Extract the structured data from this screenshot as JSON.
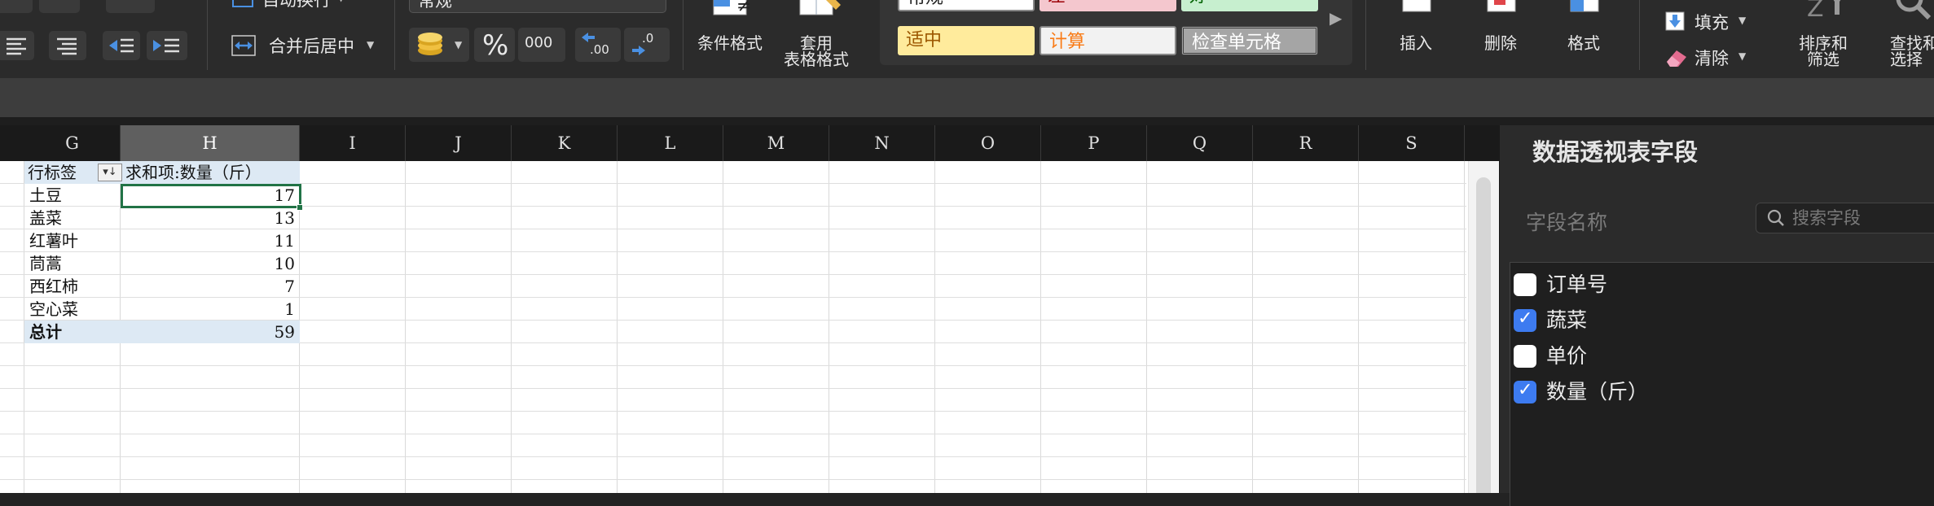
{
  "ribbon": {
    "wrap_text": "自动换行",
    "merge_center": "合并后居中",
    "number_format": "常规",
    "percent": "%",
    "thousands": "000",
    "inc_decimal": ".00",
    "dec_decimal": ".0",
    "conditional_format": "条件格式",
    "table_format_line1": "套用",
    "table_format_line2": "表格格式",
    "style_normal": "常规",
    "style_bad": "差",
    "style_good": "好",
    "style_neutral": "适中",
    "style_calc": "计算",
    "style_check": "检查单元格",
    "insert": "插入",
    "delete": "删除",
    "format": "格式",
    "fill": "填充",
    "clear": "清除",
    "sort_filter_line1": "排序和",
    "sort_filter_line2": "筛选",
    "find_select_line1": "查找和",
    "find_select_line2": "选择"
  },
  "sheet": {
    "columns": [
      "G",
      "H",
      "I",
      "J",
      "K",
      "L",
      "M",
      "N",
      "O",
      "P",
      "Q",
      "R",
      "S"
    ],
    "selected_column": "H",
    "pivot_header": {
      "row_label": "行标签",
      "value_label": "求和项:数量（斤）"
    },
    "rows": [
      {
        "label": "土豆",
        "value": "17"
      },
      {
        "label": "盖菜",
        "value": "13"
      },
      {
        "label": "红薯叶",
        "value": "11"
      },
      {
        "label": "茼蒿",
        "value": "10"
      },
      {
        "label": "西红柿",
        "value": "7"
      },
      {
        "label": "空心菜",
        "value": "1"
      }
    ],
    "total": {
      "label": "总计",
      "value": "59"
    }
  },
  "pivot_panel": {
    "title": "数据透视表字段",
    "field_name_label": "字段名称",
    "search_placeholder": "搜索字段",
    "fields": [
      {
        "name": "订单号",
        "checked": false
      },
      {
        "name": "蔬菜",
        "checked": true
      },
      {
        "name": "单价",
        "checked": false
      },
      {
        "name": "数量（斤）",
        "checked": true
      }
    ]
  },
  "colors": {
    "accent_green": "#217346",
    "checkbox_blue": "#3d7bf0",
    "pivot_band": "#dde9f4",
    "style_bad_bg": "#f4c7ce",
    "style_good_bg": "#c7efcf",
    "style_neutral_bg": "#ffeb9c",
    "style_calc_fg": "#f97b16"
  }
}
